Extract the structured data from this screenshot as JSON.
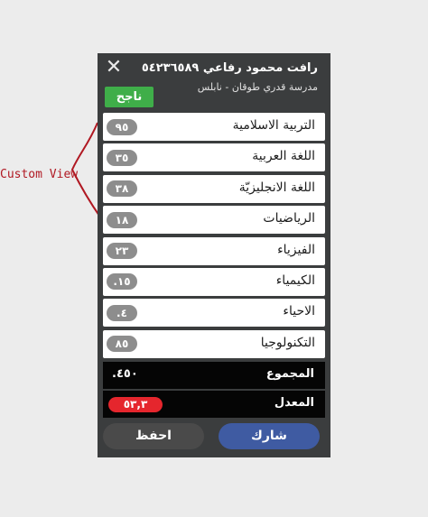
{
  "annotation": {
    "label": "Custom View",
    "color": "#b01822"
  },
  "header": {
    "close_icon": "close-icon",
    "name_number": "رافت محمود رفاعي ٥٤٢٣٦٥٨٩",
    "school": "مدرسة قدري طوقان - نابلس",
    "status": "ناجح",
    "status_color": "#3fae49"
  },
  "subjects": [
    {
      "name": "التربية الاسلامية",
      "grade": "٩٥"
    },
    {
      "name": "اللغة العربية",
      "grade": "٣٥"
    },
    {
      "name": "اللغة الانجليزيّة",
      "grade": "٣٨"
    },
    {
      "name": "الرياضيات",
      "grade": "١٨"
    },
    {
      "name": "الفيزياء",
      "grade": "٢٣"
    },
    {
      "name": "الكيمياء",
      "grade": "١٥."
    },
    {
      "name": "الاحياء",
      "grade": "٤."
    },
    {
      "name": "التكنولوجيا",
      "grade": "٨٥"
    }
  ],
  "totals": {
    "sum_label": "المجموع",
    "sum_value": "٤٥٠.",
    "avg_label": "المعدل",
    "avg_value": "٥٣,٣",
    "avg_color": "#e5262d"
  },
  "actions": {
    "share_label": "شارك",
    "save_label": "احفظ",
    "share_color": "#3f5ba2"
  }
}
